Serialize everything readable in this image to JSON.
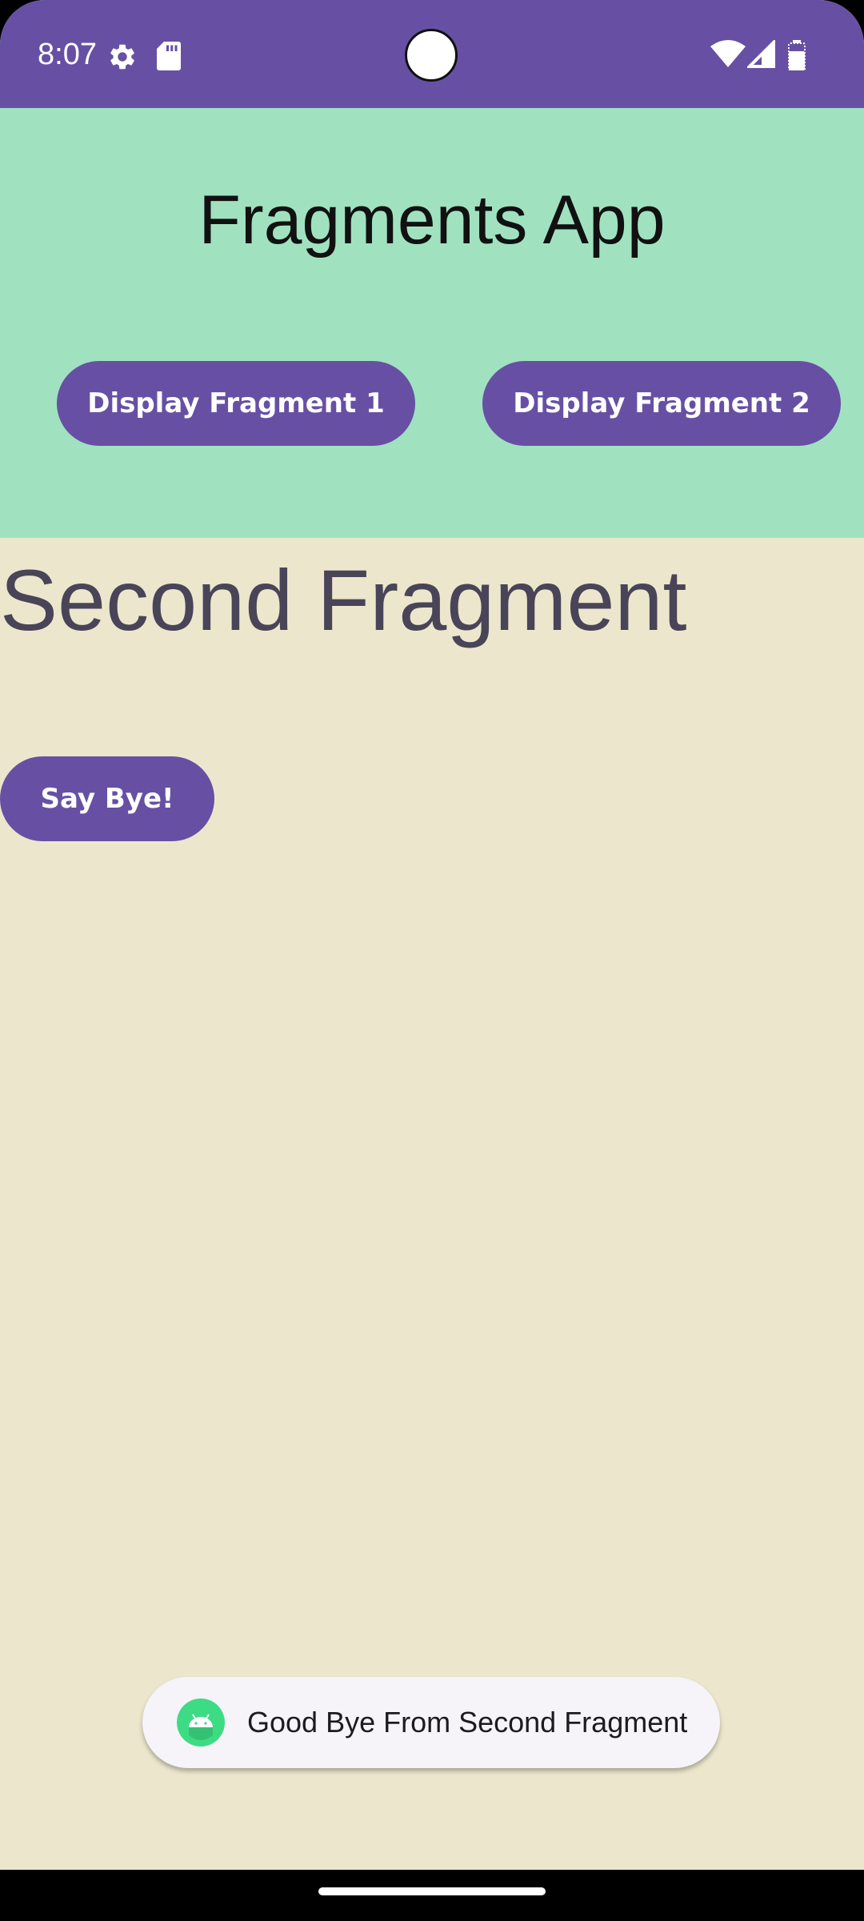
{
  "status_bar": {
    "time": "8:07",
    "icons": [
      "settings-gear-icon",
      "sd-card-icon",
      "wifi-icon",
      "cell-signal-icon",
      "battery-icon"
    ]
  },
  "header": {
    "app_title": "Fragments App",
    "buttons": {
      "fragment1_label": "Display Fragment 1",
      "fragment2_label": "Display Fragment 2"
    }
  },
  "fragment": {
    "title": "Second Fragment",
    "bye_button_label": "Say Bye!"
  },
  "toast": {
    "icon": "android-icon",
    "message": "Good Bye From Second Fragment"
  },
  "colors": {
    "primary": "#6750a4",
    "header_background": "#a0e2c0",
    "fragment_background": "#ece7cc",
    "fragment_title_text": "#4a4458",
    "toast_background": "#f6f3f9"
  }
}
